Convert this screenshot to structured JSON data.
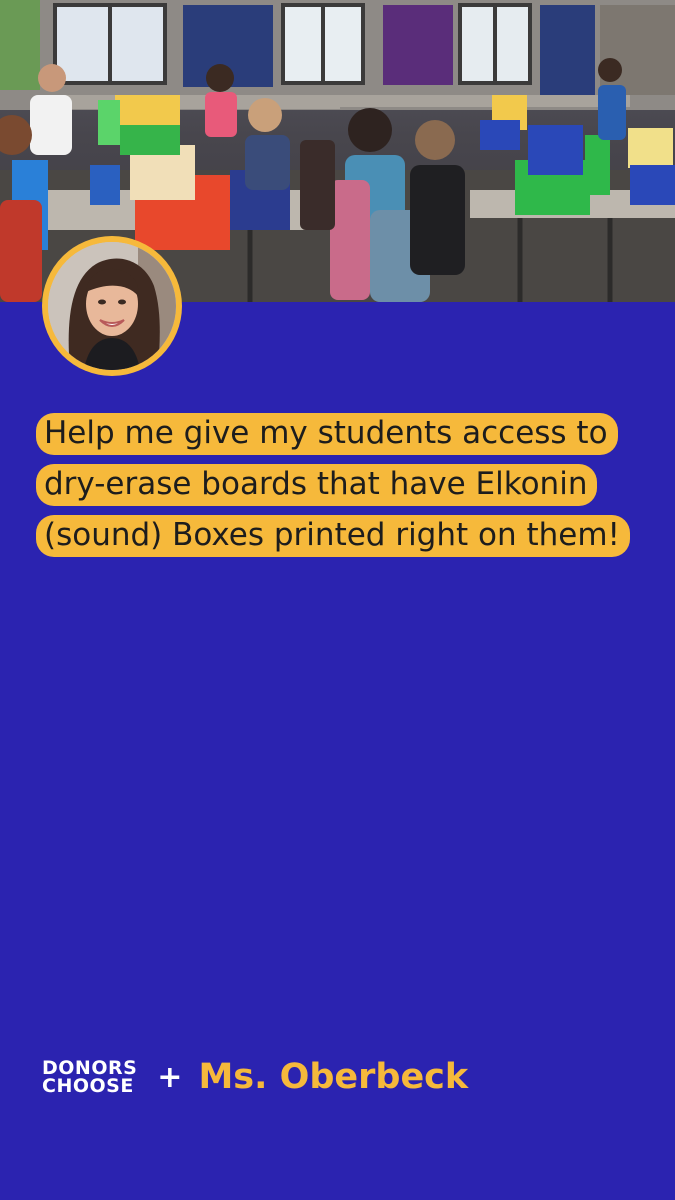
{
  "colors": {
    "background": "#2b23b0",
    "accent": "#f6b93b",
    "headline_text": "#1d1d1d",
    "logo_text": "#ffffff"
  },
  "headline": "Help me give my students access to dry-erase boards that have Elkonin (sound) Boxes printed right on them!",
  "brand": {
    "line1": "DONORS",
    "line2": "CHOOSE",
    "separator": "+"
  },
  "teacher_name": "Ms. Oberbeck"
}
